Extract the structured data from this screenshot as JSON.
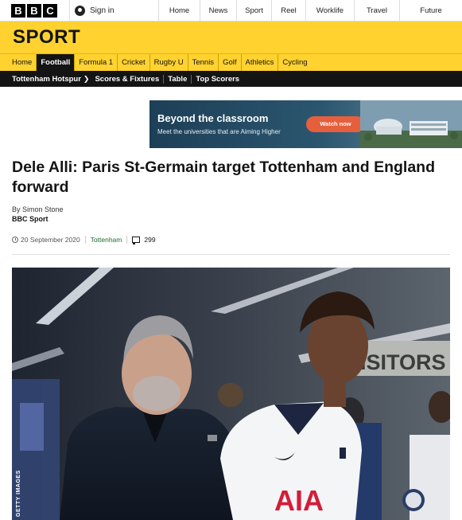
{
  "masthead": {
    "logo_letters": [
      "B",
      "B",
      "C"
    ],
    "signin_label": "Sign in",
    "nav": [
      "Home",
      "News",
      "Sport",
      "Reel",
      "Worklife",
      "Travel",
      "Future"
    ]
  },
  "section": {
    "title": "SPORT"
  },
  "sport_nav": {
    "items": [
      "Home",
      "Football",
      "Formula 1",
      "Cricket",
      "Rugby U",
      "Tennis",
      "Golf",
      "Athletics",
      "Cycling"
    ],
    "active": "Football"
  },
  "sub_nav": {
    "items": [
      "Tottenham Hotspur",
      "Scores & Fixtures",
      "Table",
      "Top Scorers"
    ]
  },
  "ad": {
    "headline": "Beyond the classroom",
    "subline": "Meet the universities that are Aiming Higher",
    "button": "Watch now"
  },
  "article": {
    "headline": "Dele Alli: Paris St-Germain target Tottenham and England forward",
    "byline": "By Simon Stone",
    "source": "BBC Sport",
    "date": "20 September 2020",
    "topic": "Tottenham",
    "comments": "299"
  },
  "photo": {
    "credit": "GETTY IMAGES",
    "kit_text": "AIA",
    "sign_text": "ISITORS"
  },
  "colors": {
    "sport_yellow": "#ffd230",
    "subnav_black": "#141414",
    "topic_green": "#1a6b2c",
    "ad_button": "#e65f3d"
  }
}
